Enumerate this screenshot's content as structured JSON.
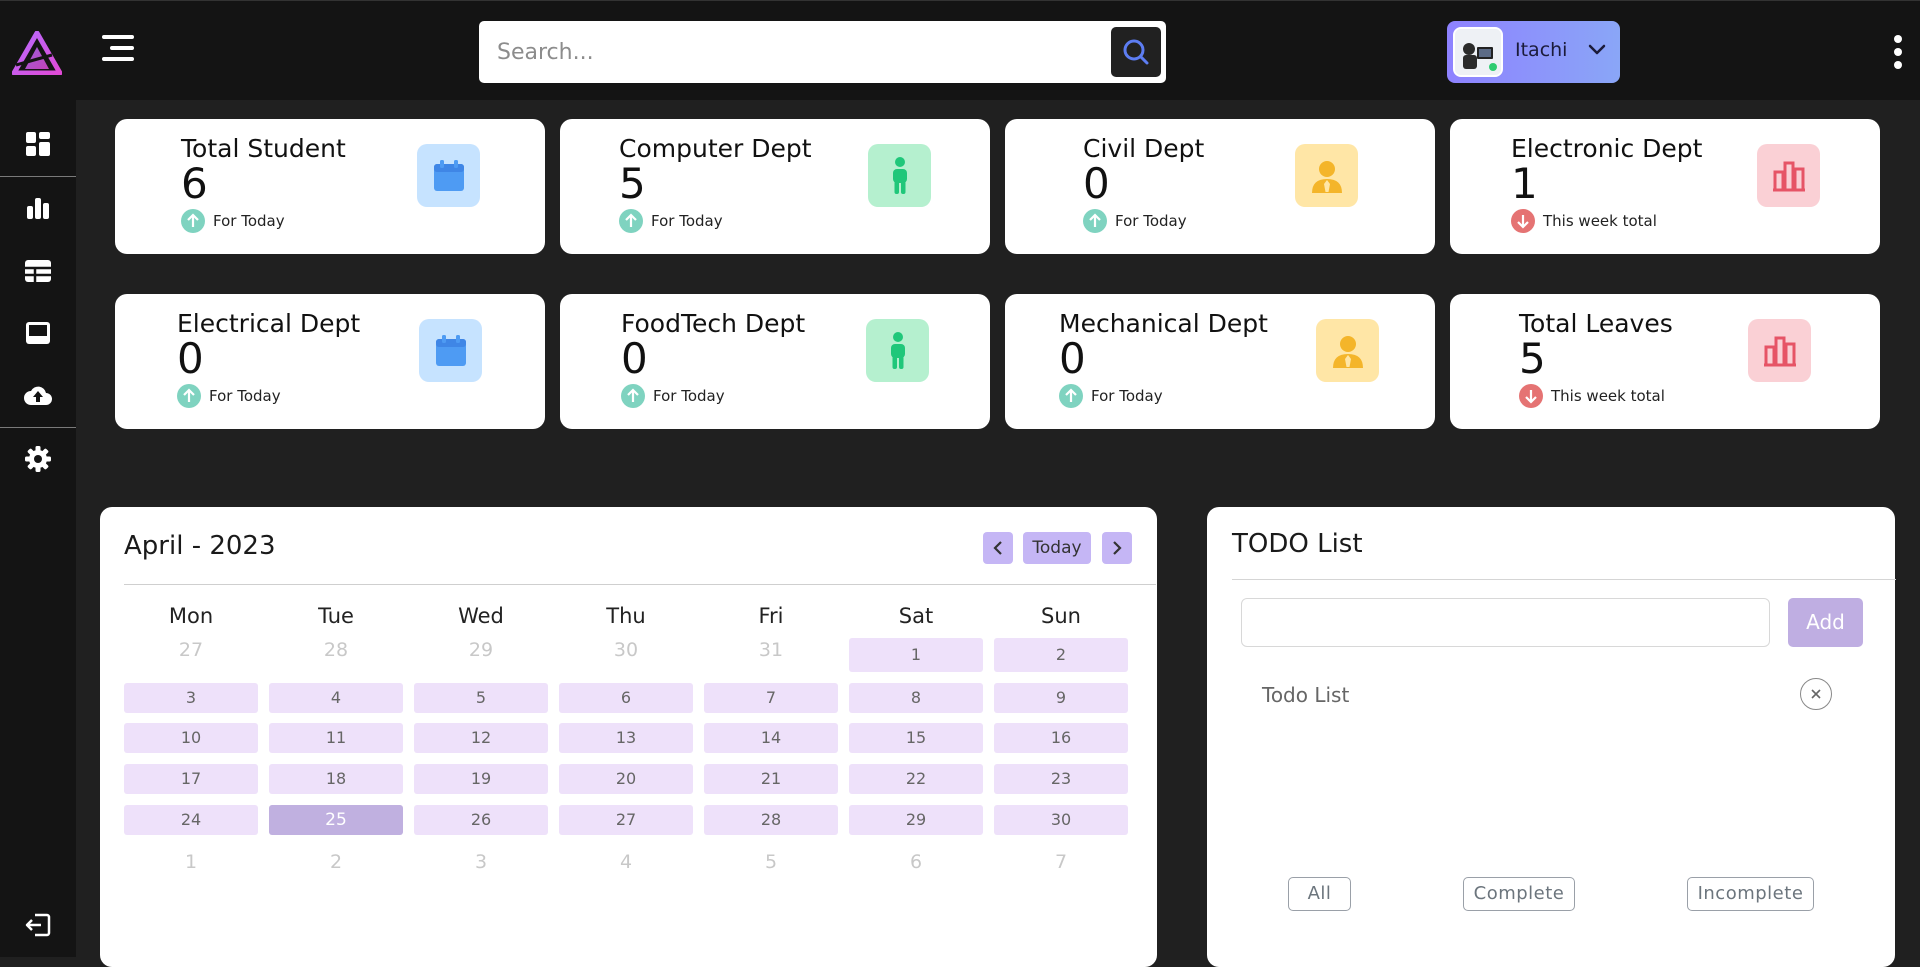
{
  "header": {
    "search_placeholder": "Search...",
    "user_name": "Itachi",
    "icons": {
      "logo": "triangle-logo",
      "menu": "hamburger-icon",
      "search": "search-icon",
      "chevron": "chevron-down-icon",
      "more": "kebab-icon"
    }
  },
  "sidebar": {
    "items": [
      {
        "name": "dashboard",
        "icon": "dashboard-icon"
      },
      {
        "name": "charts",
        "icon": "bar-chart-icon"
      },
      {
        "name": "tables",
        "icon": "table-icon"
      },
      {
        "name": "display",
        "icon": "monitor-icon"
      },
      {
        "name": "upload",
        "icon": "cloud-upload-icon"
      },
      {
        "name": "settings",
        "icon": "gear-icon"
      },
      {
        "name": "logout",
        "icon": "logout-icon"
      }
    ]
  },
  "cards": [
    {
      "title": "Total Student",
      "value": "6",
      "sub": "For Today",
      "trend": "up",
      "icon": "calendar-icon"
    },
    {
      "title": "Computer Dept",
      "value": "5",
      "sub": "For Today",
      "trend": "up",
      "icon": "person-icon"
    },
    {
      "title": "Civil Dept",
      "value": "0",
      "sub": "For Today",
      "trend": "up",
      "icon": "user-tie-icon"
    },
    {
      "title": "Electronic Dept",
      "value": "1",
      "sub": "This week total",
      "trend": "down",
      "icon": "bar-chart-icon"
    },
    {
      "title": "Electrical Dept",
      "value": "0",
      "sub": "For Today",
      "trend": "up",
      "icon": "calendar-icon"
    },
    {
      "title": "FoodTech Dept",
      "value": "0",
      "sub": "For Today",
      "trend": "up",
      "icon": "person-icon"
    },
    {
      "title": "Mechanical Dept",
      "value": "0",
      "sub": "For Today",
      "trend": "up",
      "icon": "user-tie-icon"
    },
    {
      "title": "Total Leaves",
      "value": "5",
      "sub": "This week total",
      "trend": "down",
      "icon": "bar-chart-icon"
    }
  ],
  "calendar": {
    "title": "April - 2023",
    "today_label": "Today",
    "prev_icon": "chevron-left-icon",
    "next_icon": "chevron-right-icon",
    "weekdays": [
      "Mon",
      "Tue",
      "Wed",
      "Thu",
      "Fri",
      "Sat",
      "Sun"
    ],
    "weeks": [
      [
        "27",
        "28",
        "29",
        "30",
        "31",
        "1",
        "2"
      ],
      [
        "3",
        "4",
        "5",
        "6",
        "7",
        "8",
        "9"
      ],
      [
        "10",
        "11",
        "12",
        "13",
        "14",
        "15",
        "16"
      ],
      [
        "17",
        "18",
        "19",
        "20",
        "21",
        "22",
        "23"
      ],
      [
        "24",
        "25",
        "26",
        "27",
        "28",
        "29",
        "30"
      ],
      [
        "1",
        "2",
        "3",
        "4",
        "5",
        "6",
        "7"
      ]
    ],
    "today": "25"
  },
  "todo": {
    "title": "TODO List",
    "input_value": "",
    "add_label": "Add",
    "items": [
      "Todo List"
    ],
    "remove_icon": "close-circle-icon",
    "filters": [
      "All",
      "Complete",
      "Incomplete"
    ]
  },
  "colors": {
    "accent": "#8e82ff",
    "calendar_day": "#eee1fa",
    "calendar_today": "#c0b0e0",
    "trend_up": "#7fd3c0",
    "trend_down": "#e57373"
  }
}
